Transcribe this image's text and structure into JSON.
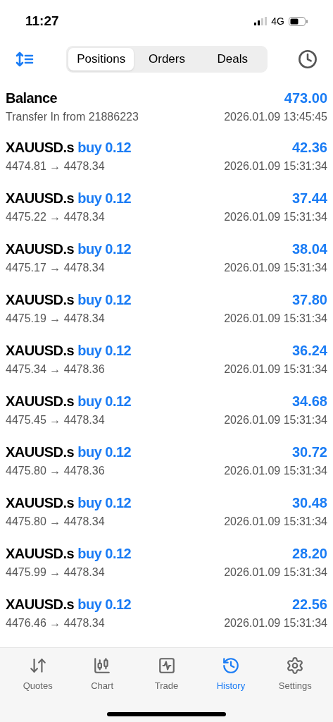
{
  "status_bar": {
    "time": "11:27",
    "network": "4G"
  },
  "toolbar": {
    "tabs": [
      {
        "label": "Positions",
        "selected": true
      },
      {
        "label": "Orders",
        "selected": false
      },
      {
        "label": "Deals",
        "selected": false
      }
    ]
  },
  "balance": {
    "title": "Balance",
    "amount": "473.00",
    "comment": "Transfer In from 21886223",
    "time": "2026.01.09 13:45:45"
  },
  "deals": [
    {
      "symbol": "XAUUSD.s",
      "side": "buy 0.12",
      "profit": "42.36",
      "prices": "4474.81 → 4478.34",
      "time": "2026.01.09 15:31:34"
    },
    {
      "symbol": "XAUUSD.s",
      "side": "buy 0.12",
      "profit": "37.44",
      "prices": "4475.22 → 4478.34",
      "time": "2026.01.09 15:31:34"
    },
    {
      "symbol": "XAUUSD.s",
      "side": "buy 0.12",
      "profit": "38.04",
      "prices": "4475.17 → 4478.34",
      "time": "2026.01.09 15:31:34"
    },
    {
      "symbol": "XAUUSD.s",
      "side": "buy 0.12",
      "profit": "37.80",
      "prices": "4475.19 → 4478.34",
      "time": "2026.01.09 15:31:34"
    },
    {
      "symbol": "XAUUSD.s",
      "side": "buy 0.12",
      "profit": "36.24",
      "prices": "4475.34 → 4478.36",
      "time": "2026.01.09 15:31:34"
    },
    {
      "symbol": "XAUUSD.s",
      "side": "buy 0.12",
      "profit": "34.68",
      "prices": "4475.45 → 4478.34",
      "time": "2026.01.09 15:31:34"
    },
    {
      "symbol": "XAUUSD.s",
      "side": "buy 0.12",
      "profit": "30.72",
      "prices": "4475.80 → 4478.36",
      "time": "2026.01.09 15:31:34"
    },
    {
      "symbol": "XAUUSD.s",
      "side": "buy 0.12",
      "profit": "30.48",
      "prices": "4475.80 → 4478.34",
      "time": "2026.01.09 15:31:34"
    },
    {
      "symbol": "XAUUSD.s",
      "side": "buy 0.12",
      "profit": "28.20",
      "prices": "4475.99 → 4478.34",
      "time": "2026.01.09 15:31:34"
    },
    {
      "symbol": "XAUUSD.s",
      "side": "buy 0.12",
      "profit": "22.56",
      "prices": "4476.46 → 4478.34",
      "time": "2026.01.09 15:31:34"
    }
  ],
  "tab_bar": [
    {
      "kind": "quotes",
      "label": "Quotes",
      "selected": false
    },
    {
      "kind": "chart",
      "label": "Chart",
      "selected": false
    },
    {
      "kind": "trade",
      "label": "Trade",
      "selected": false
    },
    {
      "kind": "history",
      "label": "History",
      "selected": true
    },
    {
      "kind": "settings",
      "label": "Settings",
      "selected": false
    }
  ]
}
